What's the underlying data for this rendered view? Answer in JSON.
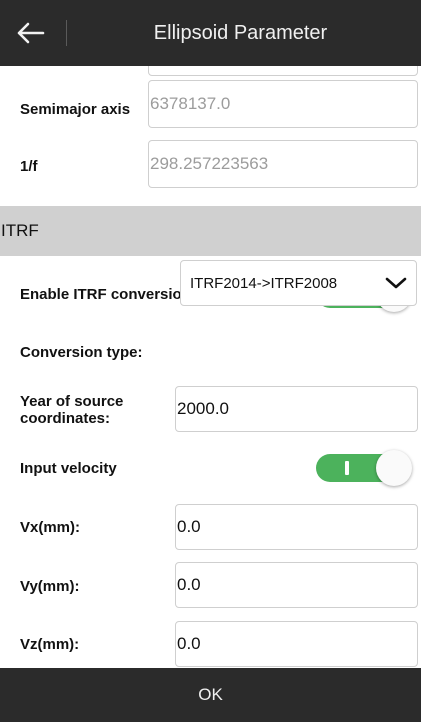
{
  "header": {
    "title": "Ellipsoid Parameter",
    "back_icon": "arrow-left-icon"
  },
  "ellipsoid": {
    "semimajor_axis": {
      "label": "Semimajor axis",
      "value": "6378137.0"
    },
    "inverse_flattening": {
      "label": "1/f",
      "value": "298.257223563"
    }
  },
  "itrf": {
    "section_title": "ITRF",
    "enable_conversion": {
      "label": "Enable ITRF conversion",
      "on": true
    },
    "conversion_type": {
      "label": "Conversion type:",
      "value": "ITRF2014->ITRF2008",
      "icon": "chevron-down-icon"
    },
    "year_source": {
      "label": "Year of source coordinates:",
      "value": "2000.0"
    },
    "input_velocity": {
      "label": "Input velocity",
      "on": true
    },
    "vx": {
      "label": "Vx(mm):",
      "value": "0.0"
    },
    "vy": {
      "label": "Vy(mm):",
      "value": "0.0"
    },
    "vz": {
      "label": "Vz(mm):",
      "value": "0.0"
    }
  },
  "footer": {
    "ok_label": "OK"
  },
  "colors": {
    "header_bg": "#2b2b2b",
    "toggle_on": "#4cb25c",
    "section_bg": "#d0d0d0",
    "border": "#cfcfcf"
  }
}
